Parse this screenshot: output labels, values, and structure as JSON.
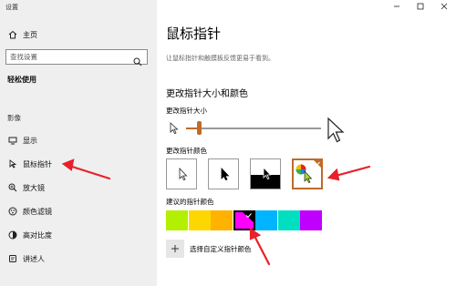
{
  "window": {
    "title": "设置"
  },
  "sidebar": {
    "home_label": "主页",
    "search_placeholder": "查找设置",
    "category_label": "轻松使用",
    "group_label": "影像",
    "items": [
      {
        "label": "显示",
        "icon": "display-icon"
      },
      {
        "label": "鼠标指针",
        "icon": "mouse-pointer-icon"
      },
      {
        "label": "放大镜",
        "icon": "magnifier-icon"
      },
      {
        "label": "颜色滤镜",
        "icon": "color-filter-icon"
      },
      {
        "label": "高对比度",
        "icon": "high-contrast-icon"
      },
      {
        "label": "讲述人",
        "icon": "narrator-icon"
      }
    ]
  },
  "main": {
    "title": "鼠标指针",
    "description": "让鼠标指针和触摸板反馈更易于看到。",
    "section_title": "更改指针大小和颜色",
    "size_label": "更改指针大小",
    "size_level": 0.1,
    "color_label": "更改指针颜色",
    "color_options": [
      "white",
      "black",
      "inverted",
      "custom"
    ],
    "selected_color_option": "custom",
    "suggested_label": "建议的指针颜色",
    "suggested_colors": [
      "#b3ef00",
      "#ffd700",
      "#ffb300",
      "#ff00ff",
      "#00b4ff",
      "#00e0c0",
      "#c000ff"
    ],
    "selected_suggested_index": 3,
    "custom_color_label": "选择自定义指针颜色"
  },
  "colors": {
    "accent": "#c06a2b",
    "annotation": "#e8202a"
  }
}
